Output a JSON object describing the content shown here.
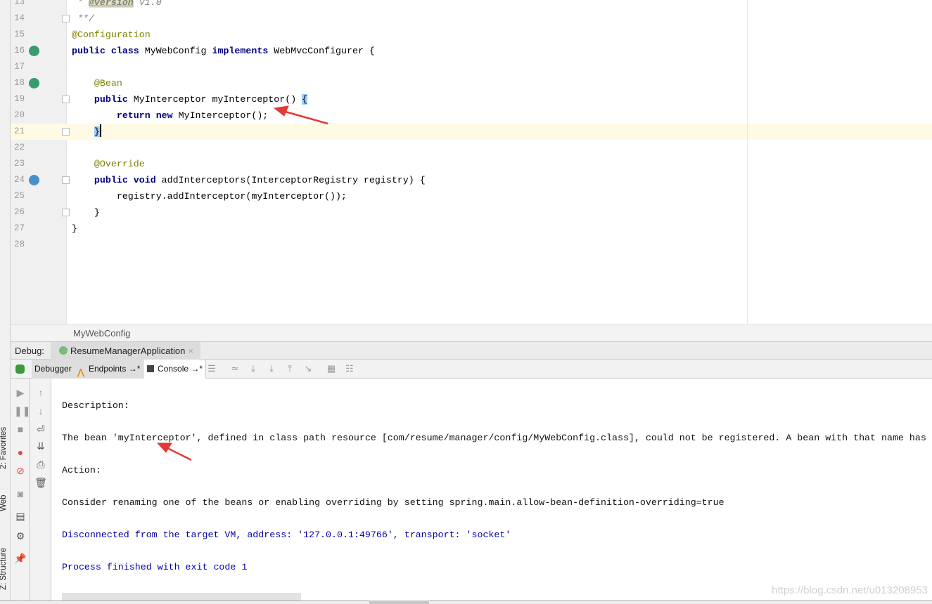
{
  "editor": {
    "lines": [
      {
        "num": "13",
        "segs": [
          [
            "cm",
            " * "
          ],
          [
            "tag",
            "@version"
          ],
          [
            "cm",
            " V1.0"
          ]
        ]
      },
      {
        "num": "14",
        "segs": [
          [
            "cm",
            " **/"
          ]
        ],
        "fold": true
      },
      {
        "num": "15",
        "segs": [
          [
            "an",
            "@Configuration"
          ]
        ]
      },
      {
        "num": "16",
        "segs": [
          [
            "kw",
            "public class "
          ],
          [
            "",
            "MyWebConfig "
          ],
          [
            "kw",
            "implements "
          ],
          [
            "",
            "WebMvcConfigurer {"
          ]
        ],
        "icon": "spring-bean-class-icon"
      },
      {
        "num": "17",
        "segs": []
      },
      {
        "num": "18",
        "segs": [
          [
            "an",
            "    @Bean"
          ]
        ],
        "icon": "spring-bean-method-icon"
      },
      {
        "num": "19",
        "segs": [
          [
            "kw",
            "    public "
          ],
          [
            "",
            "MyInterceptor myInterceptor() "
          ],
          [
            "brace",
            "{"
          ]
        ],
        "fold": true
      },
      {
        "num": "20",
        "segs": [
          [
            "kw",
            "        return new "
          ],
          [
            "",
            "MyInterceptor();"
          ]
        ]
      },
      {
        "num": "21",
        "segs": [
          [
            "",
            "    "
          ],
          [
            "brace",
            "}"
          ]
        ],
        "fold": true,
        "current": true
      },
      {
        "num": "22",
        "segs": []
      },
      {
        "num": "23",
        "segs": [
          [
            "an",
            "    @Override"
          ]
        ]
      },
      {
        "num": "24",
        "segs": [
          [
            "kw",
            "    public void "
          ],
          [
            "",
            "addInterceptors(InterceptorRegistry registry) {"
          ]
        ],
        "fold": true,
        "icon": "override-method-icon"
      },
      {
        "num": "25",
        "segs": [
          [
            "",
            "        registry.addInterceptor(myInterceptor());"
          ]
        ]
      },
      {
        "num": "26",
        "segs": [
          [
            "",
            "    }"
          ]
        ],
        "fold": true
      },
      {
        "num": "27",
        "segs": [
          [
            "",
            "}"
          ]
        ]
      },
      {
        "num": "28",
        "segs": []
      }
    ]
  },
  "breadcrumb": "MyWebConfig",
  "debug": {
    "label": "Debug:",
    "session_tab": "ResumeManagerApplication",
    "close": "×"
  },
  "toolbar": {
    "tabs": [
      {
        "label": "Debugger"
      },
      {
        "label": "Endpoints →*"
      },
      {
        "label": "Console →*"
      }
    ]
  },
  "console": {
    "lines": [
      {
        "text": "Description:",
        "blue": false
      },
      {
        "text": "The bean 'myInterceptor', defined in class path resource [com/resume/manager/config/MyWebConfig.class], could not be registered. A bean with that name has",
        "blue": false
      },
      {
        "text": "Action:",
        "blue": false
      },
      {
        "text": "Consider renaming one of the beans or enabling overriding by setting spring.main.allow-bean-definition-overriding=true",
        "blue": false
      },
      {
        "text": "Disconnected from the target VM, address: '127.0.0.1:49766', transport: 'socket'",
        "blue": true
      },
      {
        "text": "Process finished with exit code 1",
        "blue": true
      }
    ]
  },
  "side_tabs": [
    "2: Favorites",
    "Web",
    "Z: Structure"
  ],
  "watermark": "https://blog.csdn.net/u013208953",
  "colors": {
    "keyword": "#000080",
    "annotation": "#808000",
    "current_line": "#fffae3",
    "arrow": "#e53935",
    "console_blue": "#0000aa"
  }
}
